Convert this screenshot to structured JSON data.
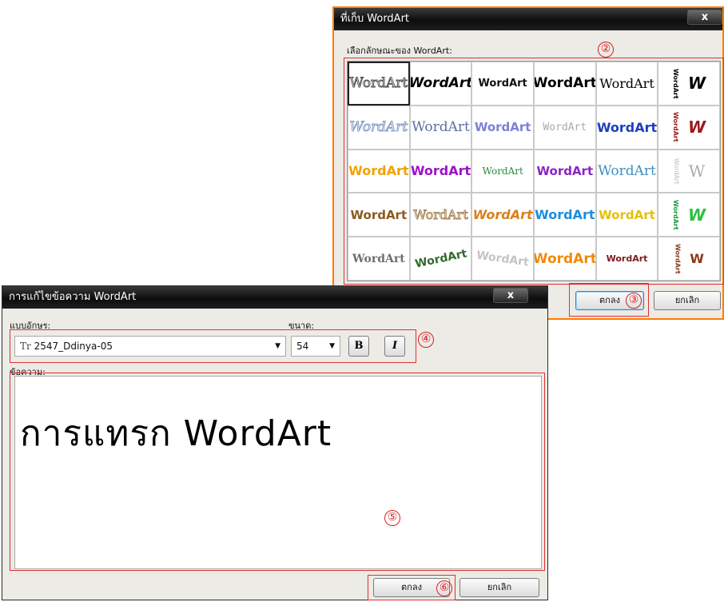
{
  "gallery": {
    "title": "ที่เก็บ WordArt",
    "close_label": "x",
    "choose_label": "เลือกลักษณะของ WordArt:",
    "styles": [
      "WordArt",
      "WordArt",
      "WordArt",
      "WordArt",
      "WordArt",
      "W",
      "WordArt",
      "WordArt",
      "WordArt",
      "WordArt",
      "WordArt",
      "W",
      "WordArt",
      "WordArt",
      "WordArt",
      "WordArt",
      "WordArt",
      "W",
      "WordArt",
      "WordArt",
      "WordArt",
      "WordArt",
      "WordArt",
      "W",
      "WordArt",
      "WordArt",
      "WordArt",
      "WordArt",
      "WordArt",
      "W"
    ],
    "ok_label": "ตกลง",
    "cancel_label": "ยกเลิก"
  },
  "edit": {
    "title": "การแก้ไขข้อความ WordArt",
    "close_label": "x",
    "font_label": "แบบอักษร:",
    "font_value": "2547_Ddinya-05",
    "size_label": "ขนาด:",
    "size_value": "54",
    "bold_label": "B",
    "italic_label": "I",
    "text_label": "ข้อความ:",
    "text_value": "การแทรก WordArt",
    "ok_label": "ตกลง",
    "cancel_label": "ยกเลิก"
  },
  "callouts": [
    "②",
    "③",
    "④",
    "⑤",
    "⑥"
  ]
}
